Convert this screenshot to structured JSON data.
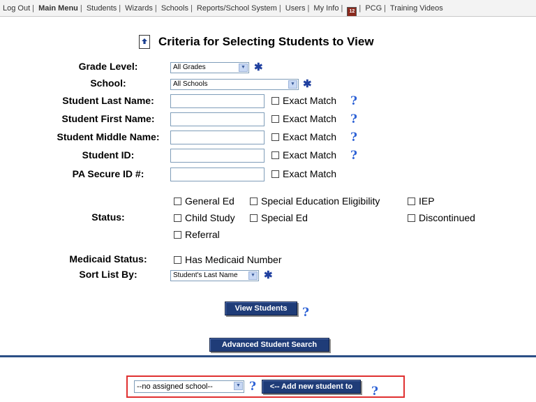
{
  "nav": {
    "items": [
      "Log Out",
      "Main Menu",
      "Students",
      "Wizards",
      "Schools",
      "Reports/School System",
      "Users",
      "My Info",
      "PCG",
      "Training Videos"
    ],
    "icon_name": "calendar-grid-icon"
  },
  "header": {
    "title": "Criteria for Selecting Students to View",
    "icon_name": "document-up-arrow-icon"
  },
  "form": {
    "grade_level": {
      "label": "Grade Level:",
      "value": "All Grades"
    },
    "school": {
      "label": "School:",
      "value": "All Schools"
    },
    "last_name": {
      "label": "Student Last Name:",
      "value": "",
      "exact_match": "Exact Match"
    },
    "first_name": {
      "label": "Student First Name:",
      "value": "",
      "exact_match": "Exact Match"
    },
    "middle_name": {
      "label": "Student Middle Name:",
      "value": "",
      "exact_match": "Exact Match"
    },
    "student_id": {
      "label": "Student ID:",
      "value": "",
      "exact_match": "Exact Match"
    },
    "pa_secure_id": {
      "label": "PA Secure ID #:",
      "value": "",
      "exact_match": "Exact Match"
    },
    "status": {
      "label": "Status:",
      "options": [
        "General Ed",
        "Special Education Eligibility",
        "IEP",
        "Child Study",
        "Special Ed",
        "Discontinued",
        "Referral"
      ]
    },
    "medicaid": {
      "label": "Medicaid Status:",
      "option": "Has Medicaid Number"
    },
    "sort": {
      "label": "Sort List By:",
      "value": "Student's Last Name"
    }
  },
  "buttons": {
    "view_students": "View Students",
    "advanced_search": "Advanced Student Search",
    "add_new_student": "<-- Add new student to"
  },
  "bottom": {
    "school_select": "--no assigned school--"
  },
  "help_glyph": "?",
  "required_glyph": "✱"
}
